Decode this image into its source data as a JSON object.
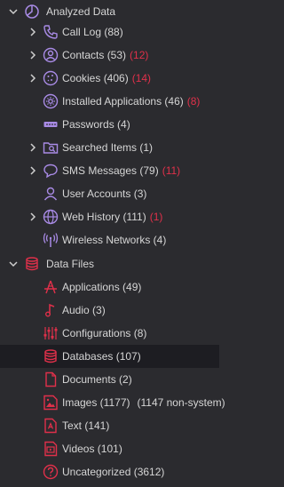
{
  "colors": {
    "background": "#2b2b2f",
    "selected_row": "#1d1d22",
    "text": "#d6d6d6",
    "accent_purple": "#a98be6",
    "accent_red": "#e0304a"
  },
  "tree": {
    "analyzed_data": {
      "label": "Analyzed Data",
      "icon": "compass-icon",
      "expanded": true,
      "children": [
        {
          "label": "Call Log (88)",
          "red": "",
          "icon": "phone-icon",
          "expandable": true
        },
        {
          "label": "Contacts (53)",
          "red": "(12)",
          "icon": "contact-icon",
          "expandable": true
        },
        {
          "label": "Cookies (406)",
          "red": "(14)",
          "icon": "cookie-icon",
          "expandable": true
        },
        {
          "label": "Installed Applications (46)",
          "red": "(8)",
          "icon": "gear-circle-icon",
          "expandable": false
        },
        {
          "label": "Passwords (4)",
          "red": "",
          "icon": "password-icon",
          "expandable": false
        },
        {
          "label": "Searched Items (1)",
          "red": "",
          "icon": "folder-search-icon",
          "expandable": true
        },
        {
          "label": "SMS Messages (79)",
          "red": "(11)",
          "icon": "message-icon",
          "expandable": true
        },
        {
          "label": "User Accounts (3)",
          "red": "",
          "icon": "user-icon",
          "expandable": false
        },
        {
          "label": "Web History (111)",
          "red": "(1)",
          "icon": "globe-icon",
          "expandable": true
        },
        {
          "label": "Wireless Networks (4)",
          "red": "",
          "icon": "wireless-icon",
          "expandable": false
        }
      ]
    },
    "data_files": {
      "label": "Data Files",
      "icon": "database-icon",
      "expanded": true,
      "children": [
        {
          "label": "Applications (49)",
          "extra": "",
          "icon": "app-icon"
        },
        {
          "label": "Audio (3)",
          "extra": "",
          "icon": "music-note-icon"
        },
        {
          "label": "Configurations (8)",
          "extra": "",
          "icon": "sliders-icon"
        },
        {
          "label": "Databases (107)",
          "extra": "",
          "icon": "database-icon",
          "selected": true
        },
        {
          "label": "Documents (2)",
          "extra": "",
          "icon": "document-icon"
        },
        {
          "label": "Images (1177)",
          "extra": "(1147 non-system)",
          "icon": "image-icon"
        },
        {
          "label": "Text (141)",
          "extra": "",
          "icon": "text-file-icon"
        },
        {
          "label": "Videos (101)",
          "extra": "",
          "icon": "video-icon"
        },
        {
          "label": "Uncategorized (3612)",
          "extra": "",
          "icon": "question-icon"
        }
      ]
    }
  }
}
